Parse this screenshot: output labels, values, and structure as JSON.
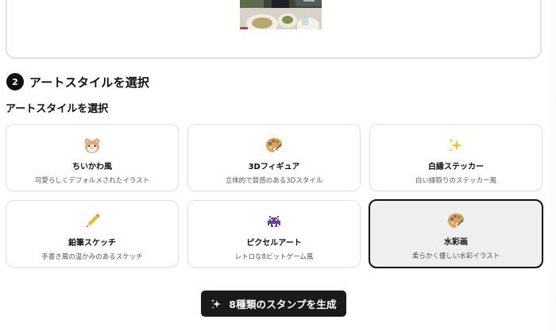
{
  "step": {
    "number": "2",
    "title": "アートスタイルを選択"
  },
  "section_label": "アートスタイルを選択",
  "styles": [
    {
      "name": "ちいかわ風",
      "description": "可愛らしくデフォルメされたイラスト",
      "icon": "hamster-icon",
      "selected": false
    },
    {
      "name": "3Dフィギュア",
      "description": "立体的で質感のある3Dスタイル",
      "icon": "palette-icon",
      "selected": false
    },
    {
      "name": "白縁ステッカー",
      "description": "白い縁取りのステッカー風",
      "icon": "sparkles-icon",
      "selected": false
    },
    {
      "name": "鉛筆スケッチ",
      "description": "手書き風の温かみのあるスケッチ",
      "icon": "pencil-icon",
      "selected": false
    },
    {
      "name": "ピクセルアート",
      "description": "レトロな8ビットゲーム風",
      "icon": "space-invader-icon",
      "selected": false
    },
    {
      "name": "水彩画",
      "description": "柔らかく優しい水彩イラスト",
      "icon": "palette-icon",
      "selected": true
    }
  ],
  "generate_button": {
    "label": "8種類のスタンプを生成",
    "icon": "sparkles-icon"
  },
  "colors": {
    "accent": "#111111",
    "selected_bg": "#efefef",
    "card_border": "#e2e2e2"
  }
}
